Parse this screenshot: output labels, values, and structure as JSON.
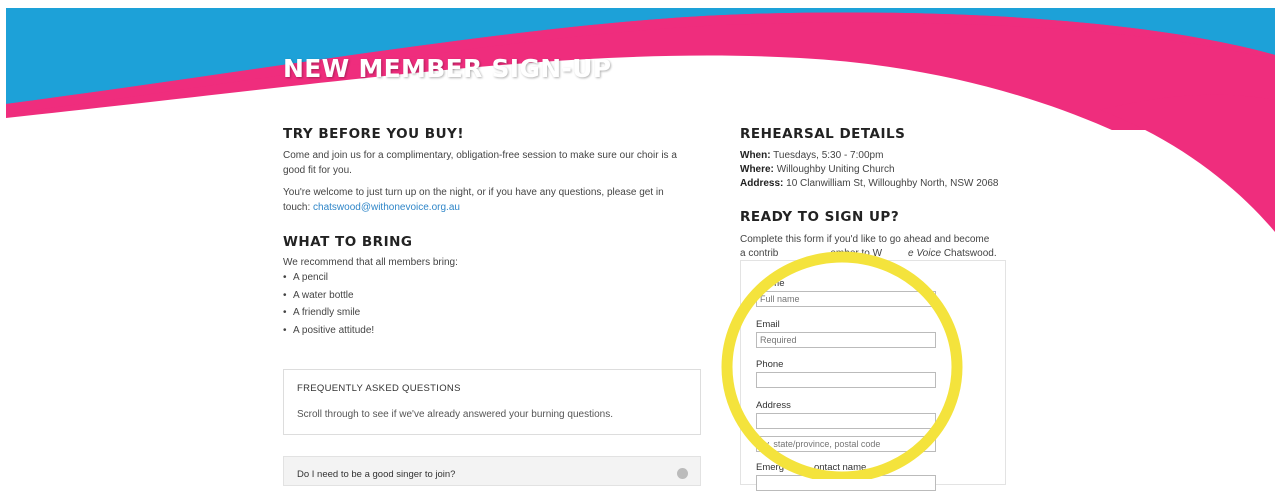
{
  "header": {
    "title": "NEW MEMBER SIGN-UP"
  },
  "colors": {
    "banner_blue": "#1da1d8",
    "banner_pink": "#ef2d7d",
    "link": "#2f86c8",
    "highlight_circle": "#f4e33c"
  },
  "left": {
    "try_heading": "TRY BEFORE YOU BUY!",
    "try_p1a": "Come and join us for a complimentary, obligation-free session to make sure our choir is a",
    "try_p1b": "good fit for you.",
    "try_p2a": "You're welcome to just turn up on the night, or if you have any questions, please get in",
    "try_p2b": "touch:",
    "email_link": "chatswood@withonevoice.org.au",
    "bring_heading": "WHAT TO BRING",
    "bring_intro": "We recommend that all members bring:",
    "bring_items": [
      "A pencil",
      "A water bottle",
      "A friendly smile",
      "A positive attitude!"
    ],
    "faq": {
      "title": "FREQUENTLY ASKED QUESTIONS",
      "desc": "Scroll through to see if we've already answered your burning questions.",
      "question1": "Do I need to be a good singer to join?"
    }
  },
  "right": {
    "rehearsal_heading": "REHEARSAL DETAILS",
    "when_label": "When:",
    "when_value": "Tuesdays, 5:30 - 7:00pm",
    "where_label": "Where:",
    "where_value": "Willoughby Uniting Church",
    "address_label": "Address:",
    "address_value": "10 Clanwilliam St, Willoughby North, NSW 2068",
    "signup_heading": "READY TO SIGN UP?",
    "signup_p1": "Complete this form if you'd like to go ahead and become",
    "signup_p2a": "a contrib",
    "signup_p2b": "ember to W",
    "signup_p2c": "e Voice",
    "signup_p2d": "Chatswood.",
    "form": {
      "name_label": "ame",
      "name_placeholder": "Full name",
      "email_label": "Email",
      "email_placeholder": "Required",
      "phone_label": "Phone",
      "address_label": "Address",
      "address2_placeholder": "ity, state/province, postal code",
      "emergency_label_a": "Emerg",
      "emergency_label_b": "ontact name"
    }
  }
}
